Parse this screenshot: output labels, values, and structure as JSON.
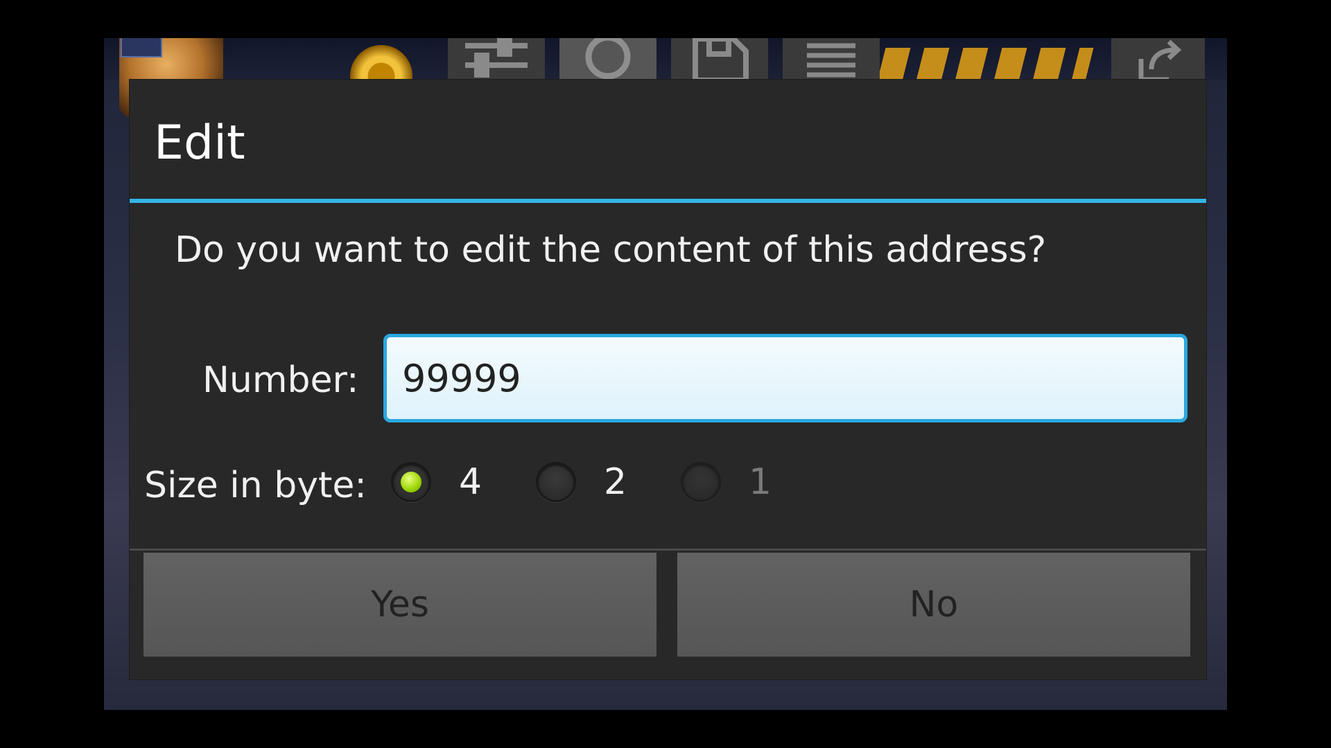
{
  "dialog": {
    "title": "Edit",
    "message": "Do you want to edit the content of this address?",
    "number_label": "Number:",
    "number_value": "99999",
    "size_label": "Size in byte:",
    "size_options": [
      {
        "label": "4",
        "selected": true,
        "enabled": true
      },
      {
        "label": "2",
        "selected": false,
        "enabled": true
      },
      {
        "label": "1",
        "selected": false,
        "enabled": false
      }
    ],
    "yes_label": "Yes",
    "no_label": "No"
  },
  "toolbar": {
    "icons": [
      "settings-sliders-icon",
      "search-icon",
      "save-icon",
      "list-icon",
      "export-icon"
    ],
    "active": "search-icon"
  },
  "colors": {
    "accent": "#33b5e5",
    "dialog_bg": "#282828",
    "radio_selected": "#9ad400",
    "button_bg": "#5c5c5c"
  }
}
